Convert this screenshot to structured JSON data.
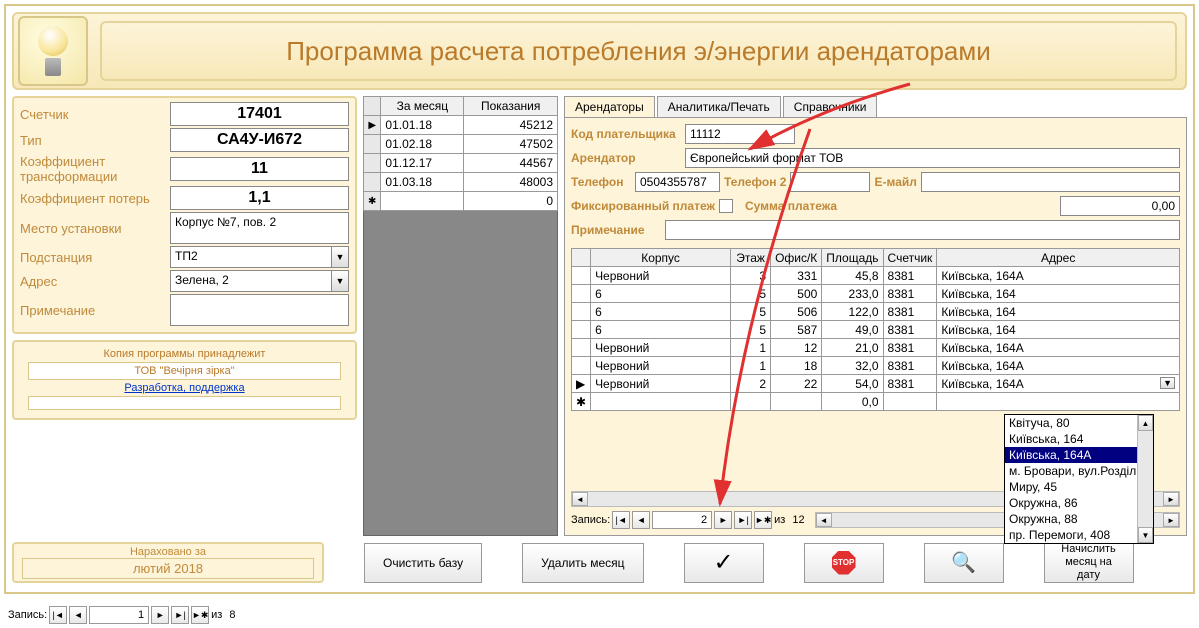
{
  "title": "Программа расчета потребления э/энергии арендаторами",
  "meter": {
    "labels": {
      "counter": "Счетчик",
      "type": "Тип",
      "koef_trans": "Коэффициент трансформации",
      "koef_loss": "Коэффициент потерь",
      "location": "Место установки",
      "substation": "Подстанция",
      "address": "Адрес",
      "note": "Примечание"
    },
    "values": {
      "counter": "17401",
      "type": "СА4У-И672",
      "koef_trans": "11",
      "koef_loss": "1,1",
      "location": "Корпус №7, пов. 2",
      "substation": "ТП2",
      "address": "Зелена, 2",
      "note": ""
    }
  },
  "credits": {
    "belongs": "Копия программы принадлежит",
    "owner": "ТОВ \"Вечірня зірка\"",
    "dev_link": "Разработка, поддержка"
  },
  "readings": {
    "headers": {
      "month": "За месяц",
      "value": "Показания"
    },
    "rows": [
      {
        "month": "01.01.18",
        "value": "45212"
      },
      {
        "month": "01.02.18",
        "value": "47502"
      },
      {
        "month": "01.12.17",
        "value": "44567"
      },
      {
        "month": "01.03.18",
        "value": "48003"
      }
    ],
    "new_value": "0"
  },
  "tabs": {
    "t1": "Арендаторы",
    "t2": "Аналитика/Печать",
    "t3": "Справочники"
  },
  "tenant": {
    "labels": {
      "payer_code": "Код плательщика",
      "tenant": "Арендатор",
      "phone": "Телефон",
      "phone2": "Телефон 2",
      "email": "Е-майл",
      "fixed_pay": "Фиксированный платеж",
      "pay_sum": "Сумма платежа",
      "note": "Примечание"
    },
    "values": {
      "payer_code": "11112",
      "tenant": "Європейський формат ТОВ",
      "phone": "0504355787",
      "phone2": "",
      "email": "",
      "pay_sum": "0,00",
      "note": ""
    }
  },
  "premises": {
    "headers": {
      "korpus": "Корпус",
      "floor": "Этаж",
      "office": "Офис/К",
      "area": "Площадь",
      "meter": "Счетчик",
      "address": "Адрес"
    },
    "rows": [
      {
        "korpus": "Червоний",
        "floor": "3",
        "office": "331",
        "area": "45,8",
        "meter": "8381",
        "address": "Київська, 164А"
      },
      {
        "korpus": "6",
        "floor": "5",
        "office": "500",
        "area": "233,0",
        "meter": "8381",
        "address": "Київська, 164"
      },
      {
        "korpus": "6",
        "floor": "5",
        "office": "506",
        "area": "122,0",
        "meter": "8381",
        "address": "Київська, 164"
      },
      {
        "korpus": "6",
        "floor": "5",
        "office": "587",
        "area": "49,0",
        "meter": "8381",
        "address": "Київська, 164"
      },
      {
        "korpus": "Червоний",
        "floor": "1",
        "office": "12",
        "area": "21,0",
        "meter": "8381",
        "address": "Київська, 164А"
      },
      {
        "korpus": "Червоний",
        "floor": "1",
        "office": "18",
        "area": "32,0",
        "meter": "8381",
        "address": "Київська, 164А"
      },
      {
        "korpus": "Червоний",
        "floor": "2",
        "office": "22",
        "area": "54,0",
        "meter": "8381",
        "address": "Київська, 164А"
      }
    ],
    "new_area": "0,0",
    "record_label": "Запись:",
    "record_current": "2",
    "record_of": "из",
    "record_total": "12"
  },
  "dropdown_items": [
    "Квітуча, 80",
    "Київська, 164",
    "Київська, 164А",
    "м. Бровари, вул.Розділ",
    "Миру, 45",
    "Окружна, 86",
    "Окружна, 88",
    "пр. Перемоги, 408"
  ],
  "dropdown_selected_index": 2,
  "accrual": {
    "label": "Нараховано за",
    "period": "лютий 2018"
  },
  "buttons": {
    "clear_db": "Очистить базу",
    "del_month": "Удалить месяц",
    "calc": "Начислить месяц на дату",
    "stop_text": "STOP"
  },
  "footer_nav": {
    "label": "Запись:",
    "current": "1",
    "of": "из",
    "total": "8"
  }
}
